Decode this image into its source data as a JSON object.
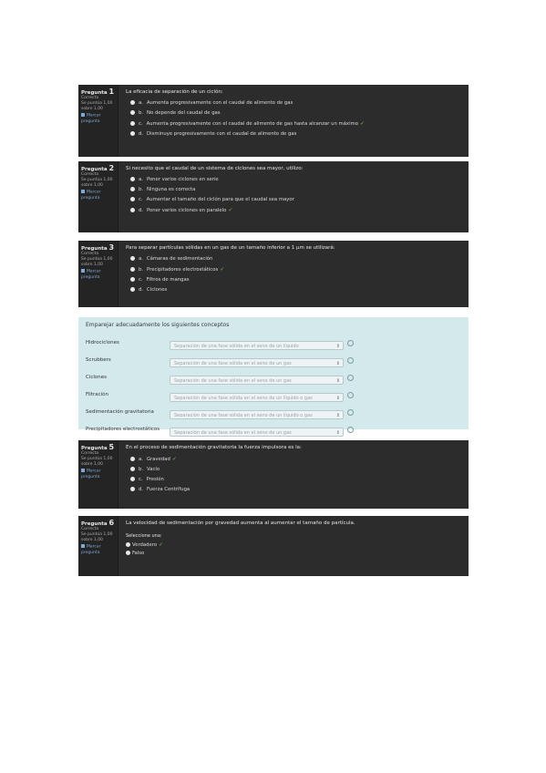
{
  "questions": [
    {
      "number": "1",
      "prefix": "Pregunta",
      "state": "Correcta",
      "mark": "Se puntúa 1,00 sobre 1,00",
      "flag": "Marcar pregunta",
      "stem": "La eficacia de separación de un ciclón:",
      "options": [
        {
          "letter": "a.",
          "text": "Aumenta progresivamente con el caudal de alimento de gas",
          "correct": false
        },
        {
          "letter": "b.",
          "text": "No depende del caudal de gas",
          "correct": false
        },
        {
          "letter": "c.",
          "text": "Aumenta progresivamente con el caudal de alimento de gas hasta alcanzar un máximo",
          "correct": true
        },
        {
          "letter": "d.",
          "text": "Disminuye progresivamente con el caudal de alimento de gas",
          "correct": false
        }
      ]
    },
    {
      "number": "2",
      "prefix": "Pregunta",
      "state": "Correcta",
      "mark": "Se puntúa 1,00 sobre 1,00",
      "flag": "Marcar pregunta",
      "stem": "Si necesito que el caudal de un sistema de ciclones sea mayor, utilizo:",
      "options": [
        {
          "letter": "a.",
          "text": "Poner varios ciclones en serie",
          "correct": false
        },
        {
          "letter": "b.",
          "text": "Ninguna es correcta",
          "correct": false
        },
        {
          "letter": "c.",
          "text": "Aumentar el tamaño del ciclón para que el caudal sea mayor",
          "correct": false
        },
        {
          "letter": "d.",
          "text": "Poner varios ciclones en paralelo",
          "correct": true
        }
      ]
    },
    {
      "number": "3",
      "prefix": "Pregunta",
      "state": "Correcta",
      "mark": "Se puntúa 1,00 sobre 1,00",
      "flag": "Marcar pregunta",
      "stem": "Para separar partículas sólidas en un gas de un tamaño inferior a 1 µm se utilizará:",
      "options": [
        {
          "letter": "a.",
          "text": "Cámaras de sedimentación",
          "correct": false
        },
        {
          "letter": "b.",
          "text": "Precipitadores electrostáticos",
          "correct": true
        },
        {
          "letter": "c.",
          "text": "Filtros de mangas",
          "correct": false
        },
        {
          "letter": "d.",
          "text": "Ciclones",
          "correct": false
        }
      ]
    },
    {
      "number": "5",
      "prefix": "Pregunta",
      "state": "Correcta",
      "mark": "Se puntúa 1,00 sobre 1,00",
      "flag": "Marcar pregunta",
      "stem": "En el proceso de sedimentación gravitatoria la fuerza impulsora es la:",
      "options": [
        {
          "letter": "a.",
          "text": "Gravedad",
          "correct": true
        },
        {
          "letter": "b.",
          "text": "Vacío",
          "correct": false
        },
        {
          "letter": "c.",
          "text": "Presión",
          "correct": false
        },
        {
          "letter": "d.",
          "text": "Fuerza Centrífuga",
          "correct": false
        }
      ]
    },
    {
      "number": "6",
      "prefix": "Pregunta",
      "state": "Correcta",
      "mark": "Se puntúa 1,00 sobre 1,00",
      "flag": "Marcar pregunta",
      "stem": "La velocidad de sedimentación por gravedad aumenta al aumentar el tamaño de partícula.",
      "select_one": "Seleccione una:",
      "options": [
        {
          "letter": "",
          "text": "Verdadero",
          "correct": true
        },
        {
          "letter": "",
          "text": "Falso",
          "correct": false
        }
      ]
    }
  ],
  "matching": {
    "title": "Emparejar adecuadamente los siguientes conceptos",
    "rows": [
      {
        "term": "Hidrociclones",
        "answer": "Separación de una fase sólida en el seno de un líquido"
      },
      {
        "term": "Scrubbers",
        "answer": "Separación de una fase sólida en el seno de un gas"
      },
      {
        "term": "Ciclones",
        "answer": "Separación de una fase sólida en el seno de un gas"
      },
      {
        "term": "Filtración",
        "answer": "Separación de una fase sólida en el seno de un líquido o gas"
      },
      {
        "term": "Sedimentación gravitatoria",
        "answer": "Separación de una fase sólida en el seno de un líquido o gas"
      },
      {
        "term": "Precipitadores electrostáticos",
        "answer": "Separación de una fase sólida en el seno de un gas"
      }
    ]
  },
  "colors": {
    "panel": "#2c2c2c",
    "sidebar": "#242424",
    "match_bg": "#d3e9ec",
    "correct": "#6ec14a"
  },
  "icons": {
    "correct": "check-icon",
    "flag": "flag-icon",
    "dropdown": "chevron-updown-icon"
  }
}
